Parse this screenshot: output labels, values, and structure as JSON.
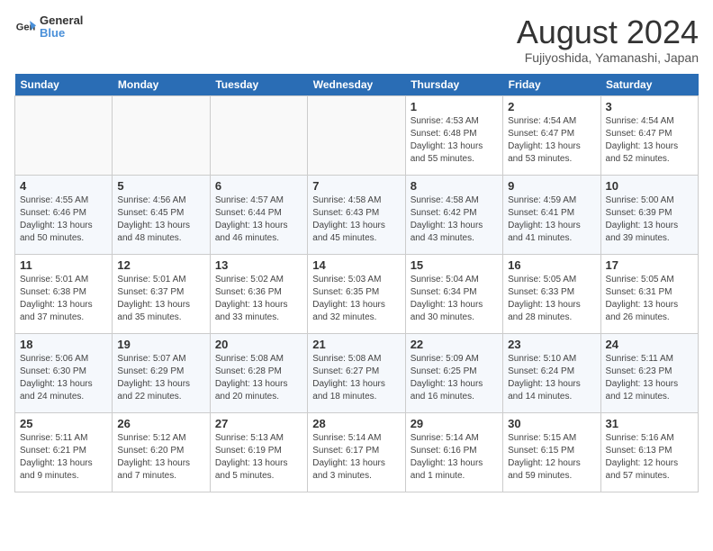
{
  "header": {
    "logo_line1": "General",
    "logo_line2": "Blue",
    "title": "August 2024",
    "subtitle": "Fujiyoshida, Yamanashi, Japan"
  },
  "weekdays": [
    "Sunday",
    "Monday",
    "Tuesday",
    "Wednesday",
    "Thursday",
    "Friday",
    "Saturday"
  ],
  "weeks": [
    [
      {
        "date": "",
        "info": ""
      },
      {
        "date": "",
        "info": ""
      },
      {
        "date": "",
        "info": ""
      },
      {
        "date": "",
        "info": ""
      },
      {
        "date": "1",
        "info": "Sunrise: 4:53 AM\nSunset: 6:48 PM\nDaylight: 13 hours\nand 55 minutes."
      },
      {
        "date": "2",
        "info": "Sunrise: 4:54 AM\nSunset: 6:47 PM\nDaylight: 13 hours\nand 53 minutes."
      },
      {
        "date": "3",
        "info": "Sunrise: 4:54 AM\nSunset: 6:47 PM\nDaylight: 13 hours\nand 52 minutes."
      }
    ],
    [
      {
        "date": "4",
        "info": "Sunrise: 4:55 AM\nSunset: 6:46 PM\nDaylight: 13 hours\nand 50 minutes."
      },
      {
        "date": "5",
        "info": "Sunrise: 4:56 AM\nSunset: 6:45 PM\nDaylight: 13 hours\nand 48 minutes."
      },
      {
        "date": "6",
        "info": "Sunrise: 4:57 AM\nSunset: 6:44 PM\nDaylight: 13 hours\nand 46 minutes."
      },
      {
        "date": "7",
        "info": "Sunrise: 4:58 AM\nSunset: 6:43 PM\nDaylight: 13 hours\nand 45 minutes."
      },
      {
        "date": "8",
        "info": "Sunrise: 4:58 AM\nSunset: 6:42 PM\nDaylight: 13 hours\nand 43 minutes."
      },
      {
        "date": "9",
        "info": "Sunrise: 4:59 AM\nSunset: 6:41 PM\nDaylight: 13 hours\nand 41 minutes."
      },
      {
        "date": "10",
        "info": "Sunrise: 5:00 AM\nSunset: 6:39 PM\nDaylight: 13 hours\nand 39 minutes."
      }
    ],
    [
      {
        "date": "11",
        "info": "Sunrise: 5:01 AM\nSunset: 6:38 PM\nDaylight: 13 hours\nand 37 minutes."
      },
      {
        "date": "12",
        "info": "Sunrise: 5:01 AM\nSunset: 6:37 PM\nDaylight: 13 hours\nand 35 minutes."
      },
      {
        "date": "13",
        "info": "Sunrise: 5:02 AM\nSunset: 6:36 PM\nDaylight: 13 hours\nand 33 minutes."
      },
      {
        "date": "14",
        "info": "Sunrise: 5:03 AM\nSunset: 6:35 PM\nDaylight: 13 hours\nand 32 minutes."
      },
      {
        "date": "15",
        "info": "Sunrise: 5:04 AM\nSunset: 6:34 PM\nDaylight: 13 hours\nand 30 minutes."
      },
      {
        "date": "16",
        "info": "Sunrise: 5:05 AM\nSunset: 6:33 PM\nDaylight: 13 hours\nand 28 minutes."
      },
      {
        "date": "17",
        "info": "Sunrise: 5:05 AM\nSunset: 6:31 PM\nDaylight: 13 hours\nand 26 minutes."
      }
    ],
    [
      {
        "date": "18",
        "info": "Sunrise: 5:06 AM\nSunset: 6:30 PM\nDaylight: 13 hours\nand 24 minutes."
      },
      {
        "date": "19",
        "info": "Sunrise: 5:07 AM\nSunset: 6:29 PM\nDaylight: 13 hours\nand 22 minutes."
      },
      {
        "date": "20",
        "info": "Sunrise: 5:08 AM\nSunset: 6:28 PM\nDaylight: 13 hours\nand 20 minutes."
      },
      {
        "date": "21",
        "info": "Sunrise: 5:08 AM\nSunset: 6:27 PM\nDaylight: 13 hours\nand 18 minutes."
      },
      {
        "date": "22",
        "info": "Sunrise: 5:09 AM\nSunset: 6:25 PM\nDaylight: 13 hours\nand 16 minutes."
      },
      {
        "date": "23",
        "info": "Sunrise: 5:10 AM\nSunset: 6:24 PM\nDaylight: 13 hours\nand 14 minutes."
      },
      {
        "date": "24",
        "info": "Sunrise: 5:11 AM\nSunset: 6:23 PM\nDaylight: 13 hours\nand 12 minutes."
      }
    ],
    [
      {
        "date": "25",
        "info": "Sunrise: 5:11 AM\nSunset: 6:21 PM\nDaylight: 13 hours\nand 9 minutes."
      },
      {
        "date": "26",
        "info": "Sunrise: 5:12 AM\nSunset: 6:20 PM\nDaylight: 13 hours\nand 7 minutes."
      },
      {
        "date": "27",
        "info": "Sunrise: 5:13 AM\nSunset: 6:19 PM\nDaylight: 13 hours\nand 5 minutes."
      },
      {
        "date": "28",
        "info": "Sunrise: 5:14 AM\nSunset: 6:17 PM\nDaylight: 13 hours\nand 3 minutes."
      },
      {
        "date": "29",
        "info": "Sunrise: 5:14 AM\nSunset: 6:16 PM\nDaylight: 13 hours\nand 1 minute."
      },
      {
        "date": "30",
        "info": "Sunrise: 5:15 AM\nSunset: 6:15 PM\nDaylight: 12 hours\nand 59 minutes."
      },
      {
        "date": "31",
        "info": "Sunrise: 5:16 AM\nSunset: 6:13 PM\nDaylight: 12 hours\nand 57 minutes."
      }
    ]
  ]
}
